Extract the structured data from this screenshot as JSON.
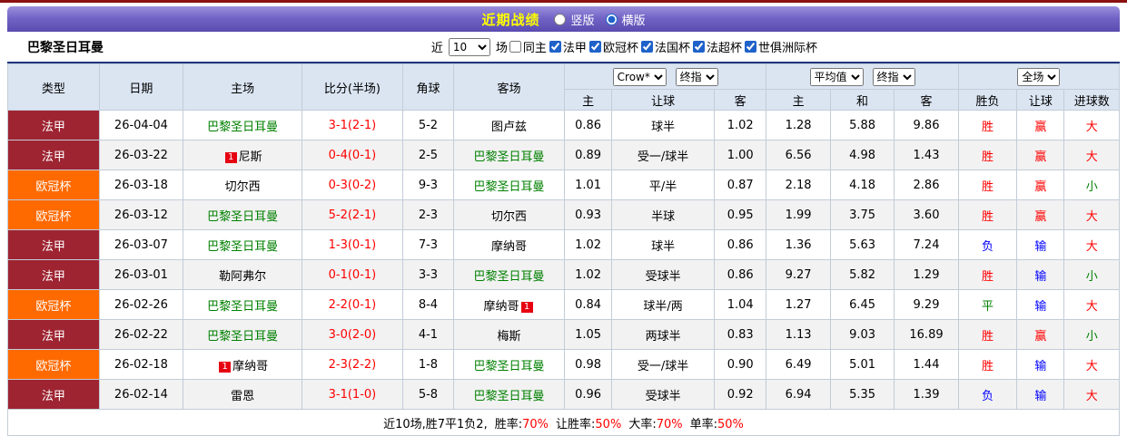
{
  "colors": {
    "title_bar_purple": "#6c5ec0",
    "title_yellow": "#ffff00",
    "ligue1_red": "#9e2432",
    "ucl_orange": "#ff6a00",
    "psg_green": "#008000",
    "win_red": "#ff0000",
    "loss_blue": "#0000ff",
    "draw_green": "#008000",
    "header_bg": "#dbe5f2",
    "filter_bar_border": "#20367e"
  },
  "page": {
    "title_bar": {
      "title": "近期战绩",
      "layout_options": [
        {
          "label": "竖版",
          "selected": false
        },
        {
          "label": "横版",
          "selected": true
        }
      ]
    },
    "filter_bar": {
      "team_name": "巴黎圣日耳曼",
      "recent_label": "近",
      "recent_count": "10",
      "matches_label": "场",
      "checkboxes": [
        {
          "label": "同主",
          "checked": false
        },
        {
          "label": "法甲",
          "checked": true
        },
        {
          "label": "欧冠杯",
          "checked": true
        },
        {
          "label": "法国杯",
          "checked": true
        },
        {
          "label": "法超杯",
          "checked": true
        },
        {
          "label": "世俱洲际杯",
          "checked": true
        }
      ]
    }
  },
  "table": {
    "selects": {
      "asian_source": "Crow*",
      "asian_time": "终指",
      "euro_source": "平均值",
      "euro_time": "终指",
      "scope": "全场"
    },
    "headers": {
      "type": "类型",
      "date": "日期",
      "home": "主场",
      "score": "比分(半场)",
      "corner": "角球",
      "away": "客场",
      "asian_home": "主",
      "asian_handicap": "让球",
      "asian_away": "客",
      "euro_home": "主",
      "euro_draw": "和",
      "euro_away": "客",
      "result": "胜负",
      "handicap_result": "让球",
      "goals": "进球数"
    },
    "rows": [
      {
        "type": {
          "label": "法甲",
          "style": "ligue1"
        },
        "date": "26-04-04",
        "home": {
          "name": "巴黎圣日耳曼",
          "psg": true
        },
        "score": "3-1(2-1)",
        "corner": "5-2",
        "away": {
          "name": "图卢兹",
          "psg": false
        },
        "asian": {
          "home": "0.86",
          "handicap": "球半",
          "away": "1.02"
        },
        "euro": {
          "home": "1.28",
          "draw": "5.88",
          "away": "9.86"
        },
        "result": {
          "text": "胜",
          "color": "red"
        },
        "handicap_result": {
          "text": "赢",
          "color": "red"
        },
        "goals": {
          "text": "大",
          "color": "red"
        }
      },
      {
        "type": {
          "label": "法甲",
          "style": "ligue1"
        },
        "date": "26-03-22",
        "home": {
          "name": "尼斯",
          "psg": false,
          "badge_before": "1"
        },
        "score": "0-4(0-1)",
        "corner": "2-5",
        "away": {
          "name": "巴黎圣日耳曼",
          "psg": true
        },
        "asian": {
          "home": "0.89",
          "handicap": "受一/球半",
          "away": "1.00"
        },
        "euro": {
          "home": "6.56",
          "draw": "4.98",
          "away": "1.43"
        },
        "result": {
          "text": "胜",
          "color": "red"
        },
        "handicap_result": {
          "text": "赢",
          "color": "red"
        },
        "goals": {
          "text": "大",
          "color": "red"
        }
      },
      {
        "type": {
          "label": "欧冠杯",
          "style": "ucl"
        },
        "date": "26-03-18",
        "home": {
          "name": "切尔西",
          "psg": false
        },
        "score": "0-3(0-2)",
        "corner": "9-3",
        "away": {
          "name": "巴黎圣日耳曼",
          "psg": true
        },
        "asian": {
          "home": "1.01",
          "handicap": "平/半",
          "away": "0.87"
        },
        "euro": {
          "home": "2.18",
          "draw": "4.18",
          "away": "2.86"
        },
        "result": {
          "text": "胜",
          "color": "red"
        },
        "handicap_result": {
          "text": "赢",
          "color": "red"
        },
        "goals": {
          "text": "小",
          "color": "green"
        }
      },
      {
        "type": {
          "label": "欧冠杯",
          "style": "ucl"
        },
        "date": "26-03-12",
        "home": {
          "name": "巴黎圣日耳曼",
          "psg": true
        },
        "score": "5-2(2-1)",
        "corner": "2-3",
        "away": {
          "name": "切尔西",
          "psg": false
        },
        "asian": {
          "home": "0.93",
          "handicap": "半球",
          "away": "0.95"
        },
        "euro": {
          "home": "1.99",
          "draw": "3.75",
          "away": "3.60"
        },
        "result": {
          "text": "胜",
          "color": "red"
        },
        "handicap_result": {
          "text": "赢",
          "color": "red"
        },
        "goals": {
          "text": "大",
          "color": "red"
        }
      },
      {
        "type": {
          "label": "法甲",
          "style": "ligue1"
        },
        "date": "26-03-07",
        "home": {
          "name": "巴黎圣日耳曼",
          "psg": true
        },
        "score": "1-3(0-1)",
        "corner": "7-3",
        "away": {
          "name": "摩纳哥",
          "psg": false
        },
        "asian": {
          "home": "1.02",
          "handicap": "球半",
          "away": "0.86"
        },
        "euro": {
          "home": "1.36",
          "draw": "5.63",
          "away": "7.24"
        },
        "result": {
          "text": "负",
          "color": "blue"
        },
        "handicap_result": {
          "text": "输",
          "color": "blue"
        },
        "goals": {
          "text": "大",
          "color": "red"
        }
      },
      {
        "type": {
          "label": "法甲",
          "style": "ligue1"
        },
        "date": "26-03-01",
        "home": {
          "name": "勒阿弗尔",
          "psg": false
        },
        "score": "0-1(0-1)",
        "corner": "3-3",
        "away": {
          "name": "巴黎圣日耳曼",
          "psg": true
        },
        "asian": {
          "home": "1.02",
          "handicap": "受球半",
          "away": "0.86"
        },
        "euro": {
          "home": "9.27",
          "draw": "5.82",
          "away": "1.29"
        },
        "result": {
          "text": "胜",
          "color": "red"
        },
        "handicap_result": {
          "text": "输",
          "color": "blue"
        },
        "goals": {
          "text": "小",
          "color": "green"
        }
      },
      {
        "type": {
          "label": "欧冠杯",
          "style": "ucl"
        },
        "date": "26-02-26",
        "home": {
          "name": "巴黎圣日耳曼",
          "psg": true
        },
        "score": "2-2(0-1)",
        "corner": "8-4",
        "away": {
          "name": "摩纳哥",
          "psg": false,
          "badge_after": "1"
        },
        "asian": {
          "home": "0.84",
          "handicap": "球半/两",
          "away": "1.04"
        },
        "euro": {
          "home": "1.27",
          "draw": "6.45",
          "away": "9.29"
        },
        "result": {
          "text": "平",
          "color": "green"
        },
        "handicap_result": {
          "text": "输",
          "color": "blue"
        },
        "goals": {
          "text": "大",
          "color": "red"
        }
      },
      {
        "type": {
          "label": "法甲",
          "style": "ligue1"
        },
        "date": "26-02-22",
        "home": {
          "name": "巴黎圣日耳曼",
          "psg": true
        },
        "score": "3-0(2-0)",
        "corner": "4-1",
        "away": {
          "name": "梅斯",
          "psg": false
        },
        "asian": {
          "home": "1.05",
          "handicap": "两球半",
          "away": "0.83"
        },
        "euro": {
          "home": "1.13",
          "draw": "9.03",
          "away": "16.89"
        },
        "result": {
          "text": "胜",
          "color": "red"
        },
        "handicap_result": {
          "text": "赢",
          "color": "red"
        },
        "goals": {
          "text": "小",
          "color": "green"
        }
      },
      {
        "type": {
          "label": "欧冠杯",
          "style": "ucl"
        },
        "date": "26-02-18",
        "home": {
          "name": "摩纳哥",
          "psg": false,
          "badge_before": "1"
        },
        "score": "2-3(2-2)",
        "corner": "1-8",
        "away": {
          "name": "巴黎圣日耳曼",
          "psg": true
        },
        "asian": {
          "home": "0.98",
          "handicap": "受一/球半",
          "away": "0.90"
        },
        "euro": {
          "home": "6.49",
          "draw": "5.01",
          "away": "1.44"
        },
        "result": {
          "text": "胜",
          "color": "red"
        },
        "handicap_result": {
          "text": "输",
          "color": "blue"
        },
        "goals": {
          "text": "大",
          "color": "red"
        }
      },
      {
        "type": {
          "label": "法甲",
          "style": "ligue1"
        },
        "date": "26-02-14",
        "home": {
          "name": "雷恩",
          "psg": false
        },
        "score": "3-1(1-0)",
        "corner": "5-8",
        "away": {
          "name": "巴黎圣日耳曼",
          "psg": true
        },
        "asian": {
          "home": "0.96",
          "handicap": "受球半",
          "away": "0.92"
        },
        "euro": {
          "home": "6.94",
          "draw": "5.35",
          "away": "1.39"
        },
        "result": {
          "text": "负",
          "color": "blue"
        },
        "handicap_result": {
          "text": "输",
          "color": "blue"
        },
        "goals": {
          "text": "大",
          "color": "red"
        }
      }
    ],
    "footer": {
      "summary": "近10场,胜7平1负2,",
      "stats": [
        {
          "label": "胜率:",
          "value": "70%"
        },
        {
          "label": "让胜率:",
          "value": "50%"
        },
        {
          "label": "大率:",
          "value": "70%"
        },
        {
          "label": "单率:",
          "value": "50%"
        }
      ]
    }
  }
}
